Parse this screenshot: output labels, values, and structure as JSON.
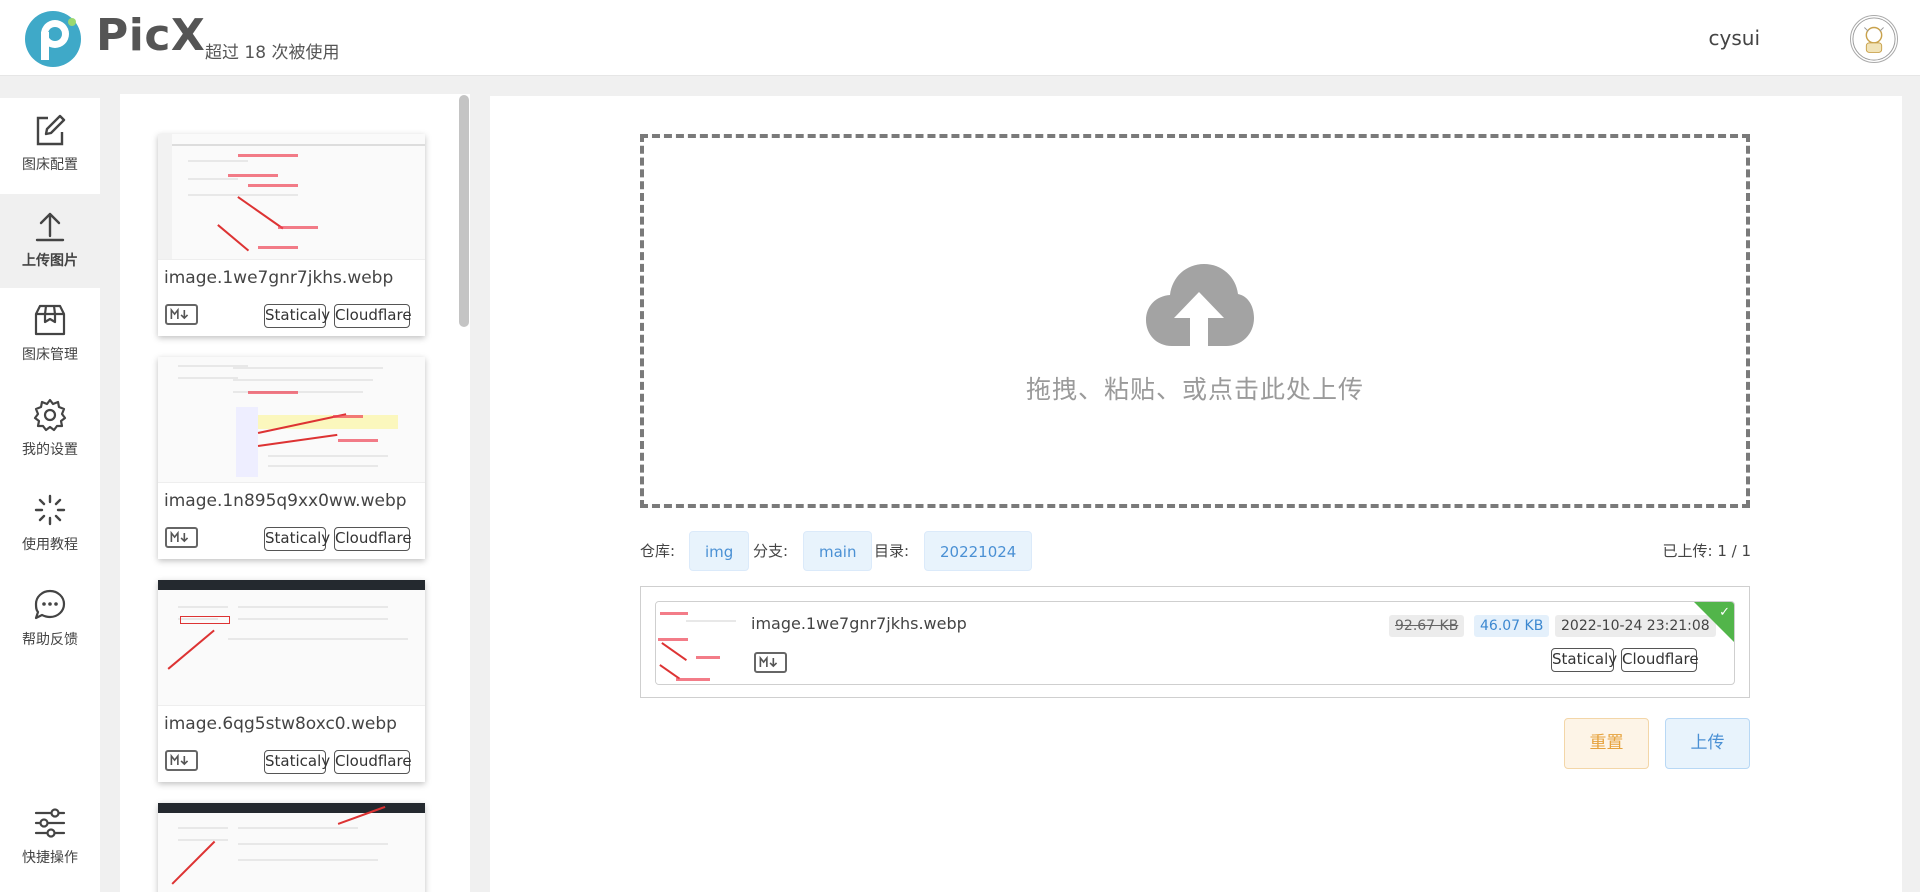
{
  "header": {
    "brand": "PicX",
    "subtitle": "超过 18 次被使用",
    "username": "cysui"
  },
  "nav": {
    "items": [
      {
        "label": "图床配置",
        "icon": "edit-icon"
      },
      {
        "label": "上传图片",
        "icon": "upload-icon",
        "active": true
      },
      {
        "label": "图床管理",
        "icon": "package-icon"
      },
      {
        "label": "我的设置",
        "icon": "gear-icon"
      },
      {
        "label": "使用教程",
        "icon": "sparkle-icon"
      },
      {
        "label": "帮助反馈",
        "icon": "chat-icon"
      },
      {
        "label": "快捷操作",
        "icon": "sliders-icon"
      }
    ]
  },
  "images": [
    {
      "name": "image.1we7gnr7jkhs.webp",
      "tags": [
        "Staticaly",
        "Cloudflare"
      ]
    },
    {
      "name": "image.1n895q9xx0ww.webp",
      "tags": [
        "Staticaly",
        "Cloudflare"
      ]
    },
    {
      "name": "image.6qg5stw8oxc0.webp",
      "tags": [
        "Staticaly",
        "Cloudflare"
      ]
    }
  ],
  "upload": {
    "drop_text": "拖拽、粘贴、或点击此处上传",
    "repo_label": "仓库:",
    "repo": "img",
    "branch_label": "分支:",
    "branch": "main",
    "dir_label": "目录:",
    "dir": "20221024",
    "uploaded_label": "已上传:",
    "uploaded_count": "1 / 1",
    "result": {
      "name": "image.1we7gnr7jkhs.webp",
      "original_size": "92.67 KB",
      "compressed_size": "46.07 KB",
      "time": "2022-10-24 23:21:08",
      "tags": [
        "Staticaly",
        "Cloudflare"
      ]
    },
    "reset_label": "重置",
    "upload_label": "上传"
  },
  "colors": {
    "accent_blue": "#4a90d4",
    "success_green": "#52b54a",
    "reset_orange": "#e6a23c"
  }
}
